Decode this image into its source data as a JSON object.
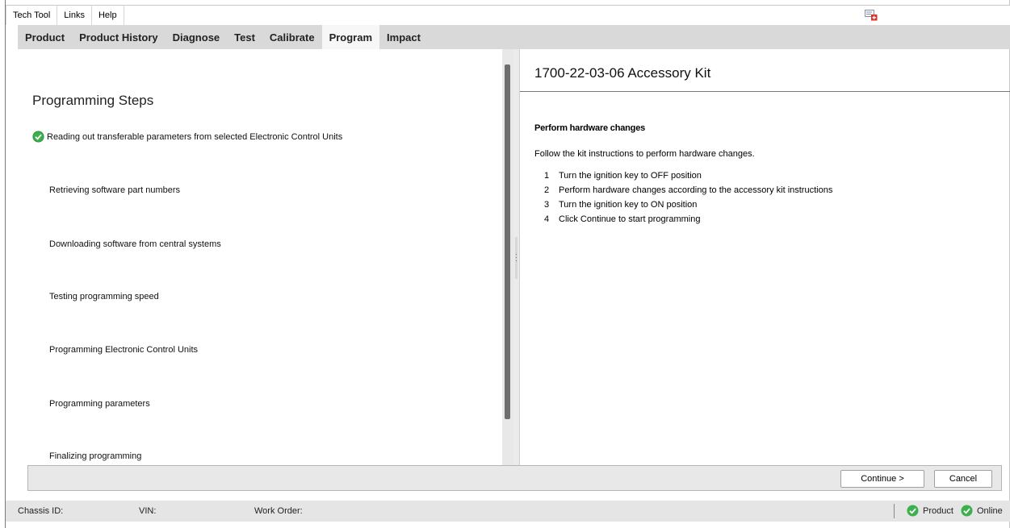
{
  "menu": {
    "items": [
      "Tech Tool",
      "Links",
      "Help"
    ]
  },
  "tabs": [
    "Product",
    "Product History",
    "Diagnose",
    "Test",
    "Calibrate",
    "Program",
    "Impact"
  ],
  "active_tab": "Program",
  "steps": {
    "title": "Programming Steps",
    "items": [
      {
        "label": "Reading out transferable parameters from selected Electronic Control Units",
        "status": "done"
      },
      {
        "label": "Retrieving software part numbers",
        "status": "pending"
      },
      {
        "label": "Downloading software from central systems",
        "status": "pending"
      },
      {
        "label": "Testing programming speed",
        "status": "pending"
      },
      {
        "label": "Programming Electronic Control Units",
        "status": "pending"
      },
      {
        "label": "Programming parameters",
        "status": "pending"
      },
      {
        "label": "Finalizing programming",
        "status": "pending"
      }
    ]
  },
  "kit": {
    "title": "1700-22-03-06 Accessory Kit",
    "section_heading": "Perform hardware changes",
    "intro": "Follow the kit instructions to perform hardware changes.",
    "instructions": [
      {
        "num": "1",
        "text": "Turn the ignition key to OFF position"
      },
      {
        "num": "2",
        "text": "Perform hardware changes according to the accessory kit instructions"
      },
      {
        "num": "3",
        "text": "Turn the ignition key to ON position"
      },
      {
        "num": "4",
        "text": "Click Continue to start programming"
      }
    ]
  },
  "actions": {
    "continue_label": "Continue >",
    "cancel_label": "Cancel"
  },
  "status_bar": {
    "chassis_label": "Chassis ID:",
    "vin_label": "VIN:",
    "work_order_label": "Work Order:",
    "indicators": [
      {
        "label": "Product",
        "state": "ok"
      },
      {
        "label": "Online",
        "state": "ok"
      }
    ]
  },
  "colors": {
    "success_green": "#3cb04c",
    "tab_bar": "#d9d9d9",
    "notification_red": "#d9322b"
  },
  "icons": {
    "step_done": "check-circle-icon",
    "notification": "notification-flag-icon",
    "status_ok": "check-circle-icon"
  }
}
